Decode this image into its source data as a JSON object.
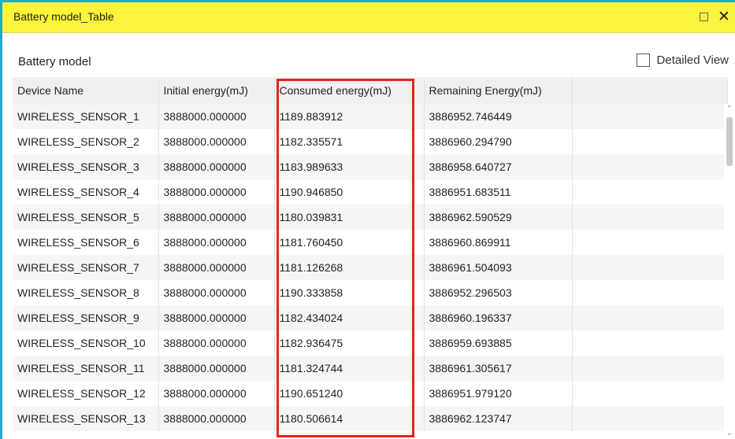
{
  "window": {
    "title": "Battery model_Table",
    "maximize_icon": "maximize-icon",
    "close_icon": "close-icon",
    "close_glyph": "✕"
  },
  "panel": {
    "title": "Battery model",
    "detailed_view_label": "Detailed View",
    "detailed_view_checked": false
  },
  "table": {
    "columns": [
      "Device Name",
      "Initial energy(mJ)",
      "Consumed energy(mJ)",
      "Remaining Energy(mJ)",
      ""
    ],
    "rows": [
      [
        "WIRELESS_SENSOR_1",
        "3888000.000000",
        "1189.883912",
        "3886952.746449"
      ],
      [
        "WIRELESS_SENSOR_2",
        "3888000.000000",
        "1182.335571",
        "3886960.294790"
      ],
      [
        "WIRELESS_SENSOR_3",
        "3888000.000000",
        "1183.989633",
        "3886958.640727"
      ],
      [
        "WIRELESS_SENSOR_4",
        "3888000.000000",
        "1190.946850",
        "3886951.683511"
      ],
      [
        "WIRELESS_SENSOR_5",
        "3888000.000000",
        "1180.039831",
        "3886962.590529"
      ],
      [
        "WIRELESS_SENSOR_6",
        "3888000.000000",
        "1181.760450",
        "3886960.869911"
      ],
      [
        "WIRELESS_SENSOR_7",
        "3888000.000000",
        "1181.126268",
        "3886961.504093"
      ],
      [
        "WIRELESS_SENSOR_8",
        "3888000.000000",
        "1190.333858",
        "3886952.296503"
      ],
      [
        "WIRELESS_SENSOR_9",
        "3888000.000000",
        "1182.434024",
        "3886960.196337"
      ],
      [
        "WIRELESS_SENSOR_10",
        "3888000.000000",
        "1182.936475",
        "3886959.693885"
      ],
      [
        "WIRELESS_SENSOR_11",
        "3888000.000000",
        "1181.324744",
        "3886961.305617"
      ],
      [
        "WIRELESS_SENSOR_12",
        "3888000.000000",
        "1190.651240",
        "3886951.979120"
      ],
      [
        "WIRELESS_SENSOR_13",
        "3888000.000000",
        "1180.506614",
        "3886962.123747"
      ]
    ]
  },
  "colors": {
    "titlebar": "#fbf33c",
    "window_border": "#2aa7c8",
    "highlight": "#e8221e"
  }
}
